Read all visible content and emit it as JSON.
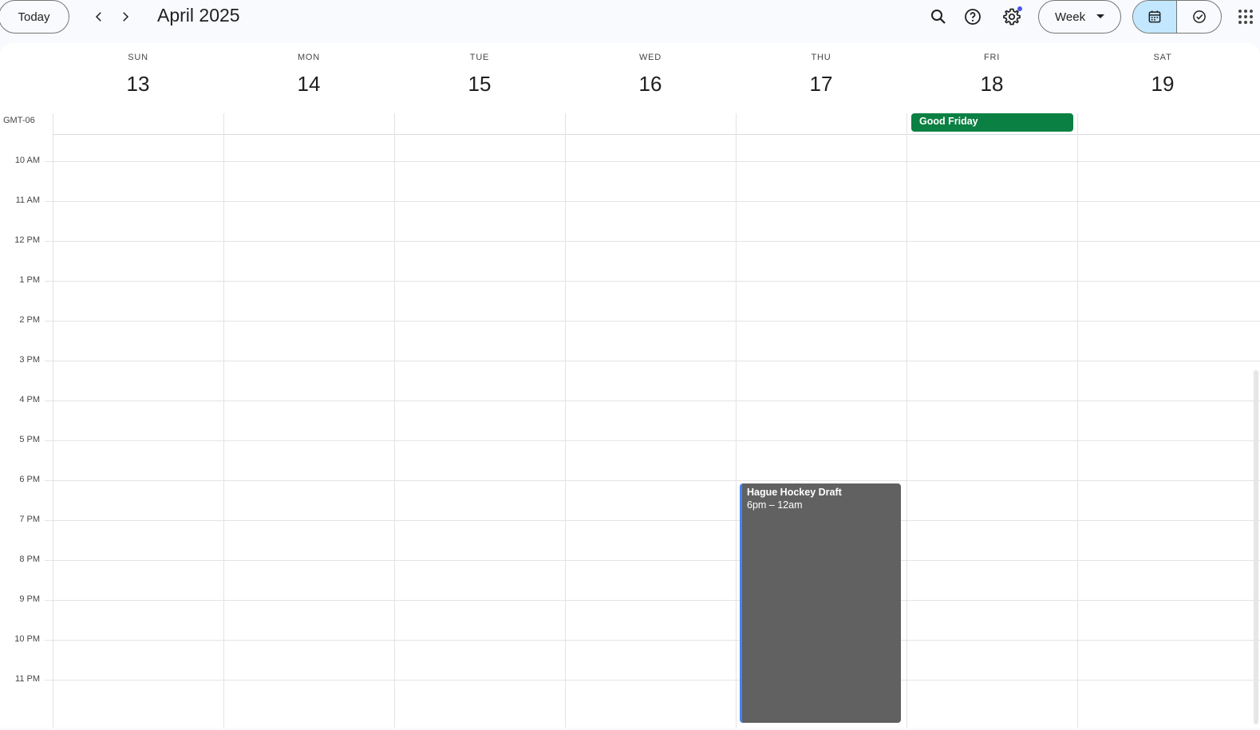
{
  "toolbar": {
    "today_label": "Today",
    "month_title": "April 2025",
    "view_label": "Week"
  },
  "icons": {
    "prev": "chevron-left-icon",
    "next": "chevron-right-icon",
    "search": "search-icon",
    "help": "help-icon",
    "settings": "gear-icon",
    "calendar_view": "calendar-icon",
    "tasks_view": "task-check-icon",
    "apps": "apps-grid-icon"
  },
  "colors": {
    "accent": "#c2e7ff",
    "holiday": "#0b8043",
    "event_bg": "#616161",
    "event_border": "#4285f4",
    "notification_dot": "#4b53e8"
  },
  "week": {
    "timezone": "GMT-06",
    "days": [
      {
        "name": "SUN",
        "number": "13"
      },
      {
        "name": "MON",
        "number": "14"
      },
      {
        "name": "TUE",
        "number": "15"
      },
      {
        "name": "WED",
        "number": "16"
      },
      {
        "name": "THU",
        "number": "17"
      },
      {
        "name": "FRI",
        "number": "18"
      },
      {
        "name": "SAT",
        "number": "19"
      }
    ],
    "hours": [
      "10 AM",
      "11 AM",
      "12 PM",
      "1 PM",
      "2 PM",
      "3 PM",
      "4 PM",
      "5 PM",
      "6 PM",
      "7 PM",
      "8 PM",
      "9 PM",
      "10 PM",
      "11 PM"
    ]
  },
  "all_day_events": [
    {
      "title": "Good Friday",
      "day": "FRI"
    }
  ],
  "events": [
    {
      "title": "Hague Hockey Draft",
      "time": "6pm – 12am",
      "day": "THU"
    }
  ]
}
